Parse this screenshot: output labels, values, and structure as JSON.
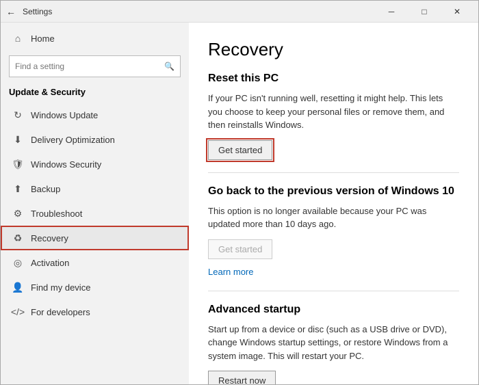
{
  "titlebar": {
    "title": "Settings",
    "back_label": "←",
    "minimize_label": "─",
    "maximize_label": "□",
    "close_label": "✕"
  },
  "sidebar": {
    "search_placeholder": "Find a setting",
    "search_icon": "🔍",
    "section_label": "Update & Security",
    "home_label": "Home",
    "nav_items": [
      {
        "id": "windows-update",
        "label": "Windows Update",
        "icon": "↻"
      },
      {
        "id": "delivery-optimization",
        "label": "Delivery Optimization",
        "icon": "⬇"
      },
      {
        "id": "windows-security",
        "label": "Windows Security",
        "icon": "🛡"
      },
      {
        "id": "backup",
        "label": "Backup",
        "icon": "⬆"
      },
      {
        "id": "troubleshoot",
        "label": "Troubleshoot",
        "icon": "↑"
      },
      {
        "id": "recovery",
        "label": "Recovery",
        "icon": "👤",
        "active": true
      },
      {
        "id": "activation",
        "label": "Activation",
        "icon": "◯"
      },
      {
        "id": "find-my-device",
        "label": "Find my device",
        "icon": "👤"
      },
      {
        "id": "for-developers",
        "label": "For developers",
        "icon": "👤"
      }
    ]
  },
  "content": {
    "page_title": "Recovery",
    "sections": [
      {
        "id": "reset-pc",
        "title": "Reset this PC",
        "body": "If your PC isn't running well, resetting it might help. This lets you choose to keep your personal files or remove them, and then reinstalls Windows.",
        "button_label": "Get started",
        "button_highlighted": true,
        "button_disabled": false
      },
      {
        "id": "go-back",
        "title": "Go back to the previous version of Windows 10",
        "body": "This option is no longer available because your PC was updated more than 10 days ago.",
        "button_label": "Get started",
        "button_highlighted": false,
        "button_disabled": true,
        "link_label": "Learn more"
      },
      {
        "id": "advanced-startup",
        "title": "Advanced startup",
        "body": "Start up from a device or disc (such as a USB drive or DVD), change Windows startup settings, or restore Windows from a system image. This will restart your PC.",
        "button_label": "Restart now",
        "button_highlighted": false,
        "button_disabled": false
      }
    ]
  }
}
